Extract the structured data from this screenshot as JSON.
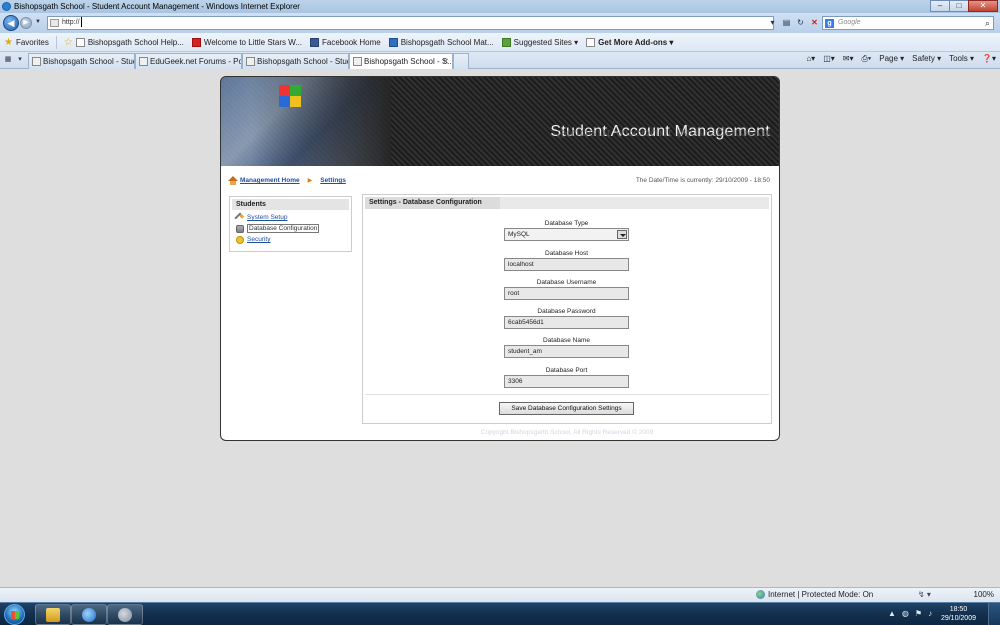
{
  "window": {
    "title": "Bishopsgath School - Student Account Management - Windows Internet Explorer",
    "controls": [
      "–",
      "□",
      "✕"
    ]
  },
  "address_bar": {
    "url": "http://"
  },
  "search_box": {
    "placeholder": "Google"
  },
  "favorites_bar": {
    "favorites_label": "Favorites",
    "items": [
      "Bishopsgath School Help...",
      "Welcome to Little Stars W...",
      "Facebook  Home",
      "Bishopsgath School Mat...",
      "Suggested Sites ▾",
      "Get More Add-ons ▾"
    ]
  },
  "tabs": [
    "Bishopsgath School - Stud...",
    "EduGeek.net Forums - Pos...",
    "Bishopsgath School - Stud...",
    "Bishopsgath School - S..."
  ],
  "command_bar": {
    "page": "Page ▾",
    "safety": "Safety ▾",
    "tools": "Tools ▾",
    "help": "❓▾"
  },
  "banner": {
    "title": "Student Account Management"
  },
  "breadcrumb": {
    "home": "Management Home",
    "settings": "Settings"
  },
  "datetime": "The Date/Time is currently: 29/10/2009 - 18:50",
  "sidebar": {
    "heading": "Students",
    "items": [
      {
        "label": "System Setup",
        "icon": "tools-icon"
      },
      {
        "label": "Database Configuration",
        "icon": "database-icon"
      },
      {
        "label": "Security",
        "icon": "lock-icon"
      }
    ]
  },
  "panel": {
    "heading": "Settings - Database Configuration",
    "fields": [
      {
        "label": "Database Type",
        "value": "MySQL"
      },
      {
        "label": "Database Host",
        "value": "localhost"
      },
      {
        "label": "Database Username",
        "value": "root"
      },
      {
        "label": "Database Password",
        "value": "6cab5456d1"
      },
      {
        "label": "Database Name",
        "value": "student_am"
      },
      {
        "label": "Database Port",
        "value": "3306"
      }
    ],
    "save_label": "Save Database Configuration Settings"
  },
  "copyright": "Copyright Bishopsgarth School, All Rights Reserved © 2009",
  "status_bar": {
    "zone": "Internet | Protected Mode: On",
    "zoom": "100%"
  },
  "taskbar": {
    "time": "18:50",
    "date": "29/10/2009"
  }
}
